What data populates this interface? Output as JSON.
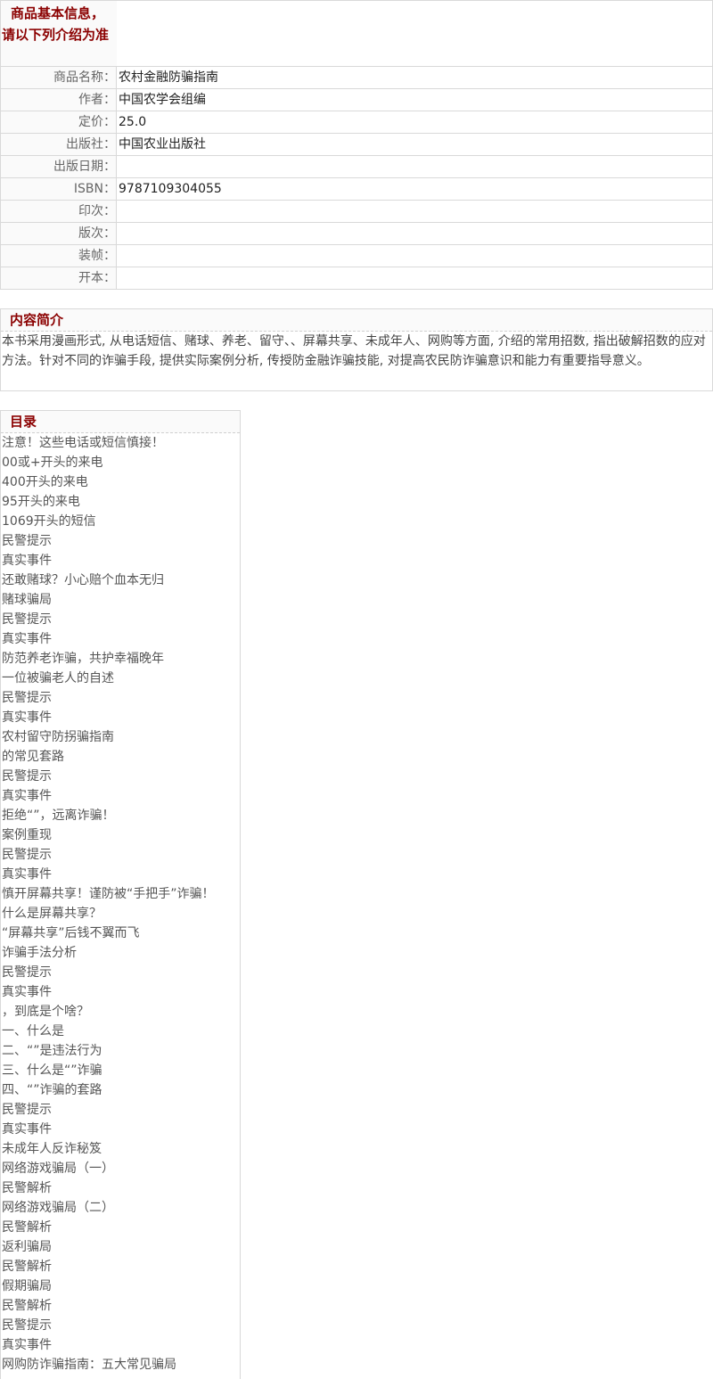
{
  "info": {
    "title": "商品基本信息，请以下列介绍为准",
    "rows": [
      {
        "label": "商品名称：",
        "value": "农村金融防骗指南"
      },
      {
        "label": "作者：",
        "value": "中国农学会组编"
      },
      {
        "label": "定价：",
        "value": "25.0"
      },
      {
        "label": "出版社：",
        "value": "中国农业出版社"
      },
      {
        "label": "出版日期：",
        "value": ""
      },
      {
        "label": "ISBN：",
        "value": "9787109304055"
      },
      {
        "label": "印次：",
        "value": ""
      },
      {
        "label": "版次：",
        "value": ""
      },
      {
        "label": "装帧：",
        "value": ""
      },
      {
        "label": "开本：",
        "value": ""
      }
    ]
  },
  "summary": {
    "title": "内容简介",
    "text": "本书采用漫画形式, 从电话短信、赌球、养老、留守、、屏幕共享、未成年人、网购等方面, 介绍的常用招数, 指出破解招数的应对方法。针对不同的诈骗手段, 提供实际案例分析, 传授防金融诈骗技能, 对提高农民防诈骗意识和能力有重要指导意义。"
  },
  "toc": {
    "title": "目录",
    "items": [
      "注意！这些电话或短信慎接！",
      "00或+开头的来电",
      "400开头的来电",
      "95开头的来电",
      "1069开头的短信",
      "民警提示",
      "真实事件",
      "还敢赌球？小心赔个血本无归",
      "赌球骗局",
      "民警提示",
      "真实事件",
      "防范养老诈骗，共护幸福晚年",
      "一位被骗老人的自述",
      "民警提示",
      "真实事件",
      "农村留守防拐骗指南",
      "的常见套路",
      "民警提示",
      "真实事件",
      "拒绝“”，远离诈骗！",
      "案例重现",
      "民警提示",
      "真实事件",
      "慎开屏幕共享！谨防被“手把手”诈骗！",
      "什么是屏幕共享？",
      "“屏幕共享”后钱不翼而飞",
      "诈骗手法分析",
      "民警提示",
      "真实事件",
      "，到底是个啥？",
      "一、什么是",
      "二、“”是违法行为",
      "三、什么是“”诈骗",
      "四、“”诈骗的套路",
      "民警提示",
      "真实事件",
      "未成年人反诈秘笈",
      "网络游戏骗局（一）",
      "民警解析",
      "网络游戏骗局（二）",
      "民警解析",
      "返利骗局",
      "民警解析",
      "假期骗局",
      "民警解析",
      "民警提示",
      "真实事件",
      "网购防诈骗指南：五大常见骗局"
    ]
  }
}
